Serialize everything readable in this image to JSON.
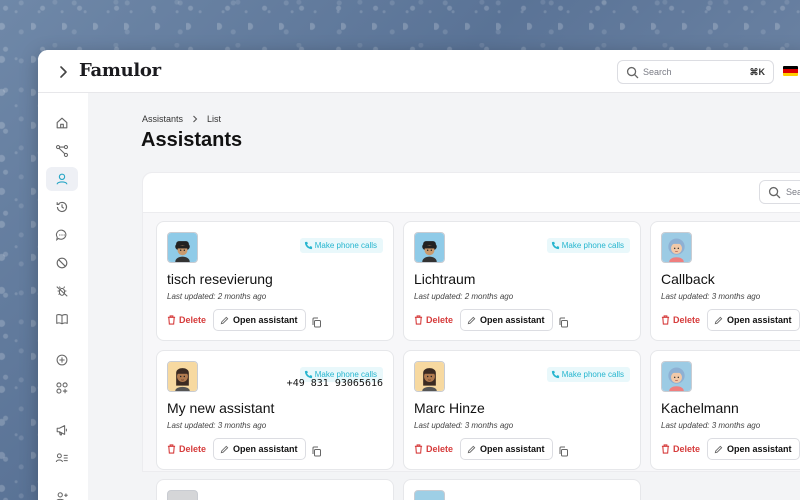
{
  "app": {
    "logo": "Famulor",
    "search_placeholder": "Search",
    "search_shortcut": "⌘K",
    "language_flag": "de-flag-icon"
  },
  "sidebar": {
    "items": [
      {
        "icon": "home-icon"
      },
      {
        "icon": "flow-icon"
      },
      {
        "icon": "user-icon",
        "active": true
      },
      {
        "icon": "history-icon"
      },
      {
        "icon": "chat-icon"
      },
      {
        "icon": "block-icon"
      },
      {
        "icon": "bug-icon"
      },
      {
        "icon": "book-icon"
      },
      {
        "icon": "plus-circle-icon"
      },
      {
        "icon": "apps-icon"
      },
      {
        "icon": "megaphone-icon"
      },
      {
        "icon": "contacts-icon"
      }
    ]
  },
  "breadcrumb": {
    "items": [
      "Assistants",
      "List"
    ]
  },
  "page": {
    "title": "Assistants",
    "table_search_placeholder": "Sear"
  },
  "cards": [
    {
      "name": "tisch resevierung",
      "updated": "Last updated: 2 months ago",
      "badge": "Make phone calls",
      "phone": "",
      "avatar": "avatar-dark-hat"
    },
    {
      "name": "Lichtraum",
      "updated": "Last updated: 2 months ago",
      "badge": "Make phone calls",
      "phone": "",
      "avatar": "avatar-dark-hat"
    },
    {
      "name": "Callback",
      "updated": "Last updated: 3 months ago",
      "badge": "",
      "phone": "",
      "avatar": "avatar-blonde"
    },
    {
      "name": "My new assistant",
      "updated": "Last updated: 3 months ago",
      "badge": "Make phone calls",
      "phone": "+49 831 93065616",
      "avatar": "avatar-braids"
    },
    {
      "name": "Marc Hinze",
      "updated": "Last updated: 3 months ago",
      "badge": "Make phone calls",
      "phone": "",
      "avatar": "avatar-braids"
    },
    {
      "name": "Kachelmann",
      "updated": "Last updated: 3 months ago",
      "badge": "",
      "phone": "",
      "avatar": "avatar-blonde"
    }
  ],
  "card_actions": {
    "delete": "Delete",
    "open": "Open assistant"
  },
  "colors": {
    "accent": "#25b5cf",
    "danger": "#d63c3c",
    "background": "#f3f4f6"
  }
}
